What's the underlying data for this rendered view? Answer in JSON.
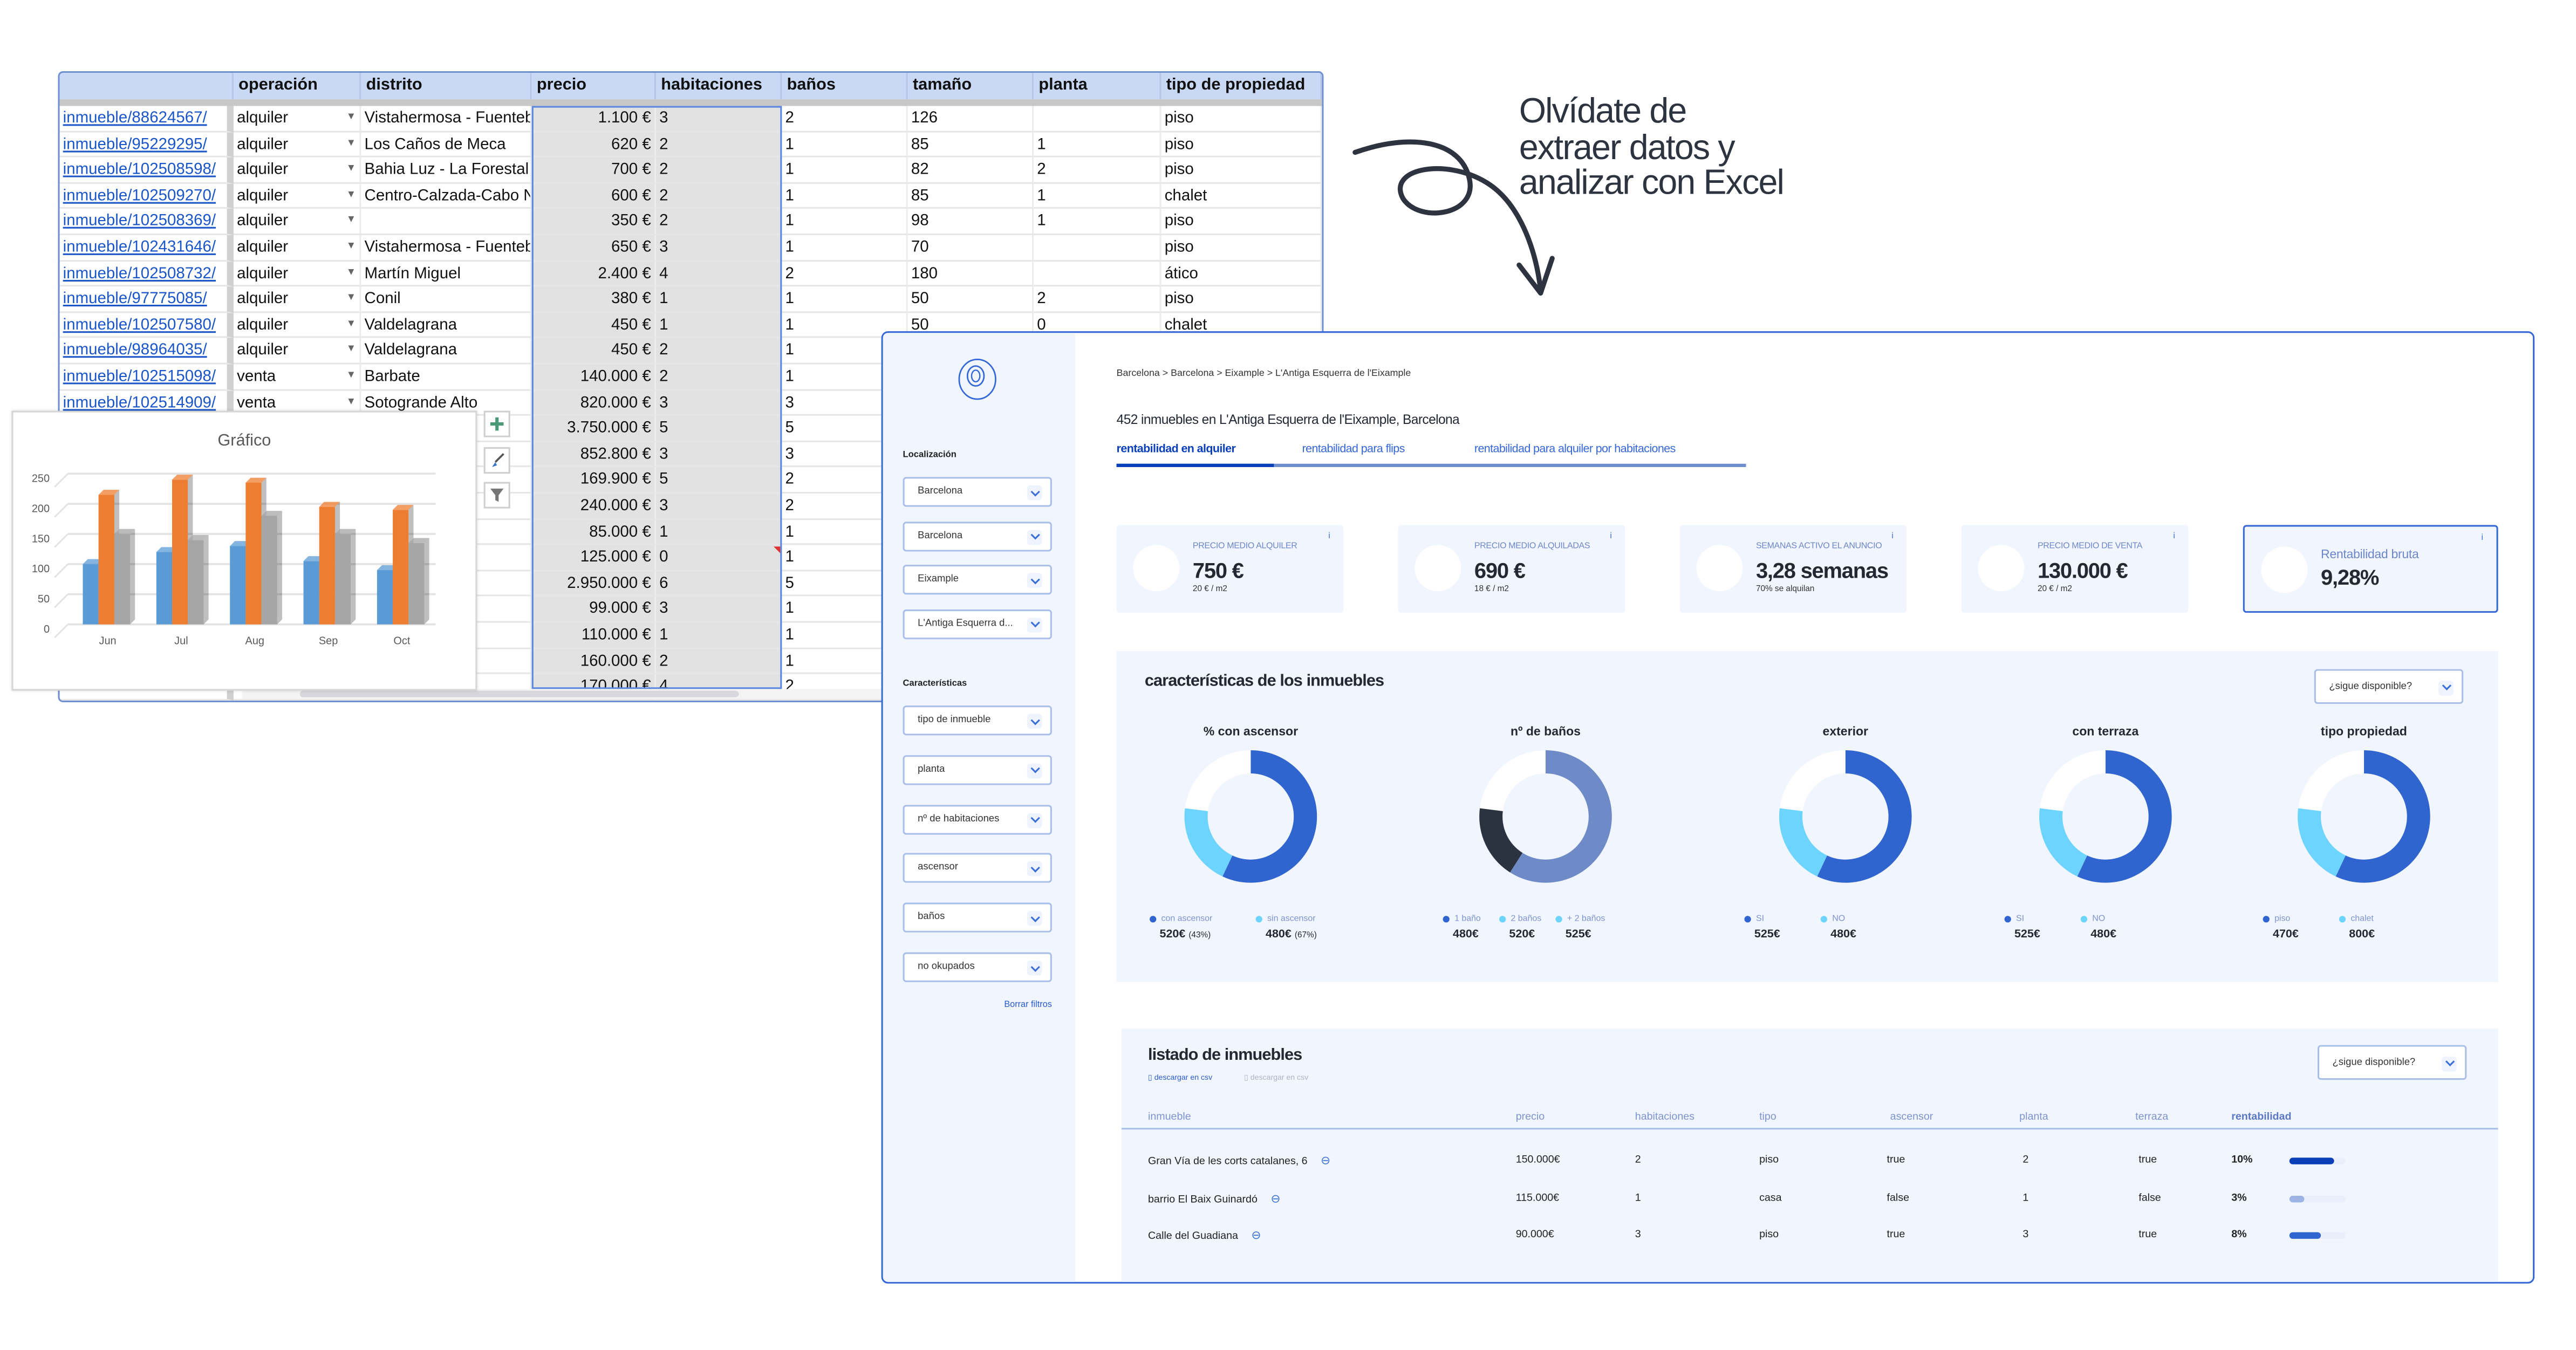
{
  "headline": [
    "Olvídate de",
    "extraer datos y",
    "analizar con Excel"
  ],
  "spreadsheet": {
    "columns": [
      "",
      "operación",
      "distrito",
      "precio",
      "habitaciones",
      "baños",
      "tamaño",
      "planta",
      "tipo de propiedad"
    ],
    "rows": [
      [
        "inmueble/88624567/",
        "alquiler",
        "Vistahermosa  - Fuentebravía",
        "1.100 €",
        "3",
        "2",
        "126",
        "",
        "piso"
      ],
      [
        "inmueble/95229295/",
        "alquiler",
        "Los Caños de Meca",
        "620 €",
        "2",
        "1",
        "85",
        "1",
        "piso"
      ],
      [
        "inmueble/102508598/",
        "alquiler",
        "Bahia Luz - La Forestal",
        "700 €",
        "2",
        "1",
        "82",
        "2",
        "piso"
      ],
      [
        "inmueble/102509270/",
        "alquiler",
        "Centro-Calzada-Cabo Noval",
        "600 €",
        "2",
        "1",
        "85",
        "1",
        "chalet"
      ],
      [
        "inmueble/102508369/",
        "alquiler",
        "",
        "350 €",
        "2",
        "1",
        "98",
        "1",
        "piso"
      ],
      [
        "inmueble/102431646/",
        "alquiler",
        "Vistahermosa  - Fuentebravía",
        "650 €",
        "3",
        "1",
        "70",
        "",
        "piso"
      ],
      [
        "inmueble/102508732/",
        "alquiler",
        "Martín Miguel",
        "2.400 €",
        "4",
        "2",
        "180",
        "",
        "ático"
      ],
      [
        "inmueble/97775085/",
        "alquiler",
        "Conil",
        "380 €",
        "1",
        "1",
        "50",
        "2",
        "piso"
      ],
      [
        "inmueble/102507580/",
        "alquiler",
        "Valdelagrana",
        "450 €",
        "1",
        "1",
        "50",
        "0",
        "chalet"
      ],
      [
        "inmueble/98964035/",
        "alquiler",
        "Valdelagrana",
        "450 €",
        "2",
        "1",
        "",
        "",
        ""
      ],
      [
        "inmueble/102515098/",
        "venta",
        "Barbate",
        "140.000 €",
        "2",
        "1",
        "",
        "",
        ""
      ],
      [
        "inmueble/102514909/",
        "venta",
        "Sotogrande Alto",
        "820.000 €",
        "3",
        "3",
        "",
        "",
        ""
      ],
      [
        "",
        "",
        "",
        "3.750.000 €",
        "5",
        "5",
        "",
        "",
        ""
      ],
      [
        "",
        "",
        "",
        "852.800 €",
        "3",
        "3",
        "",
        "",
        ""
      ],
      [
        "",
        "",
        "",
        "169.900 €",
        "5",
        "2",
        "",
        "",
        ""
      ],
      [
        "",
        "",
        "",
        "240.000 €",
        "3",
        "2",
        "",
        "",
        ""
      ],
      [
        "",
        "",
        "",
        "85.000 €",
        "1",
        "1",
        "",
        "",
        ""
      ],
      [
        "",
        "",
        "",
        "125.000 €",
        "0",
        "1",
        "",
        "",
        ""
      ],
      [
        "",
        "",
        "",
        "2.950.000 €",
        "6",
        "5",
        "",
        "",
        ""
      ],
      [
        "",
        "",
        "",
        "99.000 €",
        "3",
        "1",
        "",
        "",
        ""
      ],
      [
        "",
        "",
        "",
        "110.000 €",
        "1",
        "1",
        "",
        "",
        ""
      ],
      [
        "",
        "",
        "",
        "160.000 €",
        "2",
        "1",
        "",
        "",
        ""
      ],
      [
        "",
        "",
        "",
        "170.000 €",
        "4",
        "2",
        "",
        "",
        ""
      ]
    ]
  },
  "chart_data": {
    "type": "bar",
    "title": "Gráfico",
    "categories": [
      "Jun",
      "Jul",
      "Aug",
      "Sep",
      "Oct"
    ],
    "series": [
      {
        "values": [
          100,
          120,
          130,
          105,
          90
        ],
        "color": "#5b9bd5"
      },
      {
        "values": [
          215,
          240,
          235,
          195,
          190
        ],
        "color": "#ed7d31"
      },
      {
        "values": [
          150,
          140,
          180,
          150,
          135
        ],
        "color": "#a5a5a5"
      }
    ],
    "yticks": [
      0,
      50,
      100,
      150,
      200,
      250
    ],
    "ylim": [
      0,
      250
    ],
    "grid": true,
    "xlabel": "",
    "ylabel": ""
  },
  "chart_tools": [
    "plus-icon",
    "brush-icon",
    "filter-icon"
  ],
  "dashboard": {
    "sidebar": {
      "localizacion_label": "Localización",
      "localizacion": [
        "Barcelona",
        "Barcelona",
        "Eixample",
        "L'Antiga Esquerra d..."
      ],
      "caracteristicas_label": "Características",
      "caracteristicas": [
        "tipo de inmueble",
        "planta",
        "nº de habitaciones",
        "ascensor",
        "baños",
        "no okupados"
      ],
      "clear_filters": "Borrar filtros"
    },
    "breadcrumb": "Barcelona > Barcelona > Eixample > L'Antiga Esquerra de l'Eixample",
    "title": "452 inmuebles en L'Antiga Esquerra de l'Eixample, Barcelona",
    "tabs": [
      "rentabilidad en alquiler",
      "rentabilidad para flips",
      "rentabilidad para alquiler por habitaciones"
    ],
    "active_tab": 0,
    "kpis": [
      {
        "label": "PRECIO MEDIO ALQUILER",
        "value": "750 €",
        "sub": "20 € / m2"
      },
      {
        "label": "PRECIO MEDIO ALQUILADAS",
        "value": "690 €",
        "sub": "18 € / m2"
      },
      {
        "label": "SEMANAS ACTIVO EL ANUNCIO",
        "value": "3,28 semanas",
        "sub": "70% se alquilan"
      },
      {
        "label": "PRECIO MEDIO DE VENTA",
        "value": "130.000 €",
        "sub": "20 € / m2"
      },
      {
        "label": "Rentabilidad bruta",
        "value": "9,28%",
        "sub": ""
      }
    ],
    "info_glyph": "i",
    "features": {
      "title": "características de los inmuebles",
      "filter": "¿sigue disponible?",
      "donuts": [
        {
          "title": "% con ascensor",
          "segments": [
            0.57,
            0.2,
            0.23
          ],
          "colors": [
            "#3064ce",
            "#6dd3ff",
            "#ffffff"
          ],
          "legend": [
            {
              "label": "con ascensor",
              "value": "520€",
              "pct": "(43%)",
              "color": "#3064ce"
            },
            {
              "label": "sin ascensor",
              "value": "480€",
              "pct": "(67%)",
              "color": "#6dd3ff"
            }
          ]
        },
        {
          "title": "nº de baños",
          "segments": [
            0.59,
            0.18,
            0.23
          ],
          "colors": [
            "#6e8bc8",
            "#2b3240",
            "#ffffff"
          ],
          "legend": [
            {
              "label": "1 baño",
              "value": "480€",
              "color": "#3064ce"
            },
            {
              "label": "2 baños",
              "value": "520€",
              "color": "#6dd3ff"
            },
            {
              "label": "+ 2 baños",
              "value": "525€",
              "color": "#6dd3ff"
            }
          ]
        },
        {
          "title": "exterior",
          "segments": [
            0.57,
            0.2,
            0.23
          ],
          "colors": [
            "#3064ce",
            "#6dd3ff",
            "#ffffff"
          ],
          "legend": [
            {
              "label": "SI",
              "value": "525€",
              "color": "#3064ce"
            },
            {
              "label": "NO",
              "value": "480€",
              "color": "#6dd3ff"
            }
          ]
        },
        {
          "title": "con terraza",
          "segments": [
            0.57,
            0.2,
            0.23
          ],
          "colors": [
            "#3064ce",
            "#6dd3ff",
            "#ffffff"
          ],
          "legend": [
            {
              "label": "SI",
              "value": "525€",
              "color": "#3064ce"
            },
            {
              "label": "NO",
              "value": "480€",
              "color": "#6dd3ff"
            }
          ]
        },
        {
          "title": "tipo propiedad",
          "segments": [
            0.57,
            0.2,
            0.23
          ],
          "colors": [
            "#3064ce",
            "#6dd3ff",
            "#ffffff"
          ],
          "legend": [
            {
              "label": "piso",
              "value": "470€",
              "color": "#3064ce"
            },
            {
              "label": "chalet",
              "value": "800€",
              "color": "#6dd3ff"
            }
          ]
        }
      ]
    },
    "listing": {
      "title": "listado de inmuebles",
      "csv_links": [
        "descargar en csv",
        "descargar en csv"
      ],
      "filter": "¿sigue disponible?",
      "columns": [
        "inmueble",
        "precio",
        "habitaciones",
        "tipo",
        "ascensor",
        "planta",
        "terraza",
        "rentabilidad"
      ],
      "rows": [
        {
          "inmueble": "Gran Vía de les corts catalanes, 6",
          "precio": "150.000€",
          "habitaciones": "2",
          "tipo": "piso",
          "ascensor": "true",
          "planta": "2",
          "terraza": "true",
          "rentabilidad": "10%",
          "level": 0.8,
          "bar_color": "#0a3fb8"
        },
        {
          "inmueble": "barrio El Baix Guinardó",
          "precio": "115.000€",
          "habitaciones": "1",
          "tipo": "casa",
          "ascensor": "false",
          "planta": "1",
          "terraza": "false",
          "rentabilidad": "3%",
          "level": 0.25,
          "bar_color": "#9db4e4"
        },
        {
          "inmueble": "Calle del Guadiana",
          "precio": "90.000€",
          "habitaciones": "3",
          "tipo": "piso",
          "ascensor": "true",
          "planta": "3",
          "terraza": "true",
          "rentabilidad": "8%",
          "level": 0.55,
          "bar_color": "#3064ce"
        }
      ]
    }
  }
}
